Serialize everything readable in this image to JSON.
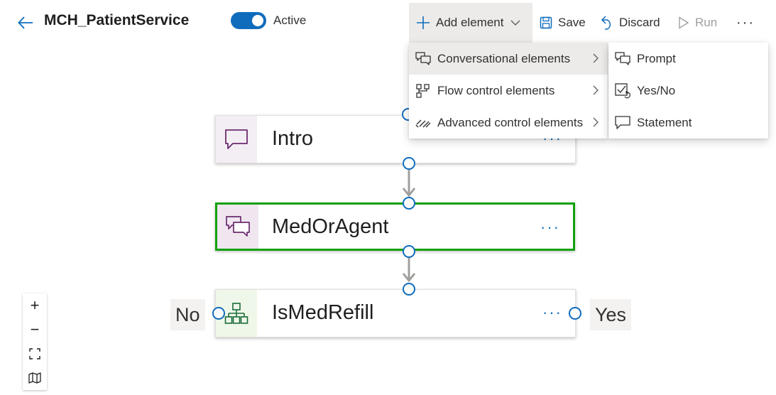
{
  "header": {
    "title": "MCH_PatientService",
    "toggle_label": "Active",
    "toggle_on": true
  },
  "toolbar": {
    "add_element": "Add element",
    "save": "Save",
    "discard": "Discard",
    "run": "Run",
    "more": "···"
  },
  "add_menu": {
    "items": [
      {
        "label": "Conversational elements",
        "icon": "conversation-icon",
        "selected": true
      },
      {
        "label": "Flow control elements",
        "icon": "flow-control-icon"
      },
      {
        "label": "Advanced control elements",
        "icon": "advanced-control-icon"
      }
    ]
  },
  "submenu": {
    "items": [
      {
        "label": "Prompt",
        "icon": "prompt-icon"
      },
      {
        "label": "Yes/No",
        "icon": "yes-no-icon"
      },
      {
        "label": "Statement",
        "icon": "statement-icon"
      }
    ]
  },
  "flow": {
    "nodes": [
      {
        "label": "Intro",
        "icon": "statement-icon",
        "more": "···"
      },
      {
        "label": "MedOrAgent",
        "icon": "prompt-icon",
        "more": "···",
        "selected": true
      },
      {
        "label": "IsMedRefill",
        "icon": "branch-icon",
        "more": "···"
      }
    ],
    "branches": {
      "no": "No",
      "yes": "Yes"
    }
  },
  "zoom": {
    "zoom_in": "+",
    "zoom_out": "−"
  },
  "colors": {
    "accent": "#0f6cbd",
    "selected_border": "#13a10e",
    "conversation_icon": "#6b2c6e",
    "branch_icon": "#1b6c3a"
  }
}
